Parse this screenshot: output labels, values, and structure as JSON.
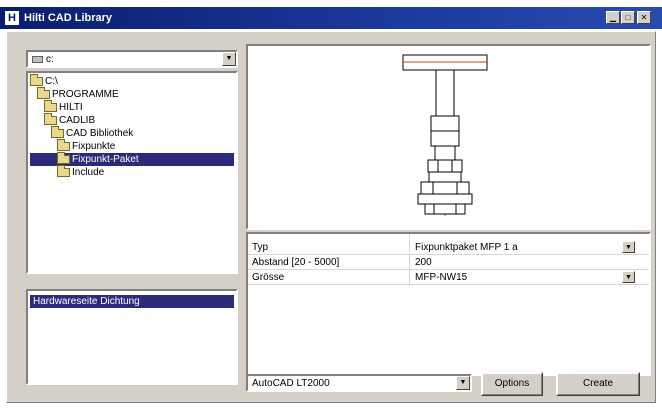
{
  "window": {
    "icon": "H",
    "title": "Hilti CAD Library",
    "controls": [
      "minimize-icon",
      "maximize-icon",
      "close-icon"
    ]
  },
  "drive_combo": {
    "value": "c:"
  },
  "tree": {
    "items": [
      {
        "label": "C:\\",
        "depth": 0,
        "icon": "folder-icon"
      },
      {
        "label": "PROGRAMME",
        "depth": 1,
        "icon": "folder-icon"
      },
      {
        "label": "HILTI",
        "depth": 2,
        "icon": "folder-icon"
      },
      {
        "label": "CADLIB",
        "depth": 2,
        "icon": "folder-icon"
      },
      {
        "label": "CAD Bibliothek",
        "depth": 3,
        "icon": "folder-icon"
      },
      {
        "label": "Fixpunkte",
        "depth": 4,
        "icon": "folder-icon"
      },
      {
        "label": "Fixpunkt-Paket",
        "depth": 4,
        "icon": "folder-open-icon",
        "selected": true
      },
      {
        "label": "Include",
        "depth": 4,
        "icon": "folder-icon"
      }
    ]
  },
  "lower_list": {
    "items": [
      "Hardwareseite Dichtung"
    ]
  },
  "properties": {
    "rows": [
      {
        "label": "Typ",
        "value": "Fixpunktpaket MFP 1 a",
        "has_dropdown": true
      },
      {
        "label": "Abstand [20 - 5000]",
        "value": "200",
        "has_dropdown": false
      },
      {
        "label": "Grösse",
        "value": "MFP-NW15",
        "has_dropdown": true
      }
    ]
  },
  "cad_select": {
    "value": "AutoCAD LT2000"
  },
  "buttons": {
    "options": "Options",
    "create": "Create"
  },
  "colors": {
    "titlebar": "#0a1d6c",
    "selection": "#2b2b7a",
    "preview_accent": "#c04a1a"
  }
}
